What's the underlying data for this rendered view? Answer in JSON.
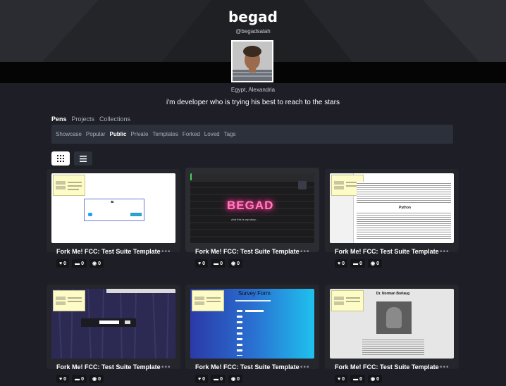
{
  "profile": {
    "name": "begad",
    "handle": "@begadsalah",
    "location": "Egypt, Alexandria",
    "bio": "i'm developer who is trying his best to reach to the stars"
  },
  "tabs": [
    "Pens",
    "Projects",
    "Collections"
  ],
  "subnav": [
    "Showcase",
    "Popular",
    "Public",
    "Private",
    "Templates",
    "Forked",
    "Loved",
    "Tags"
  ],
  "view_toggle": {
    "grid_icon": "grid-icon",
    "list_icon": "list-icon"
  },
  "cards": [
    {
      "title": "Fork Me! FCC: Test Suite Template",
      "likes": "0",
      "comments": "0",
      "views": "0"
    },
    {
      "title": "Fork Me! FCC: Test Suite Template",
      "likes": "0",
      "comments": "0",
      "views": "0",
      "preview_text": "BEGAD",
      "preview_sub": "And this is my story..."
    },
    {
      "title": "Fork Me! FCC: Test Suite Template",
      "likes": "0",
      "comments": "0",
      "views": "0",
      "preview_heading": "Python"
    },
    {
      "title": "Fork Me! FCC: Test Suite Template",
      "likes": "0",
      "comments": "0",
      "views": "0"
    },
    {
      "title": "Fork Me! FCC: Test Suite Template",
      "likes": "0",
      "comments": "0",
      "views": "0",
      "preview_text": "Survey Form"
    },
    {
      "title": "Fork Me! FCC: Test Suite Template",
      "likes": "0",
      "comments": "0",
      "views": "0",
      "preview_text": "Dr. Norman Borlaug"
    }
  ],
  "colors": {
    "background": "#1e1f26",
    "subnav": "#2c303a",
    "card": "#25262c",
    "neon": "#ff4fa3"
  }
}
